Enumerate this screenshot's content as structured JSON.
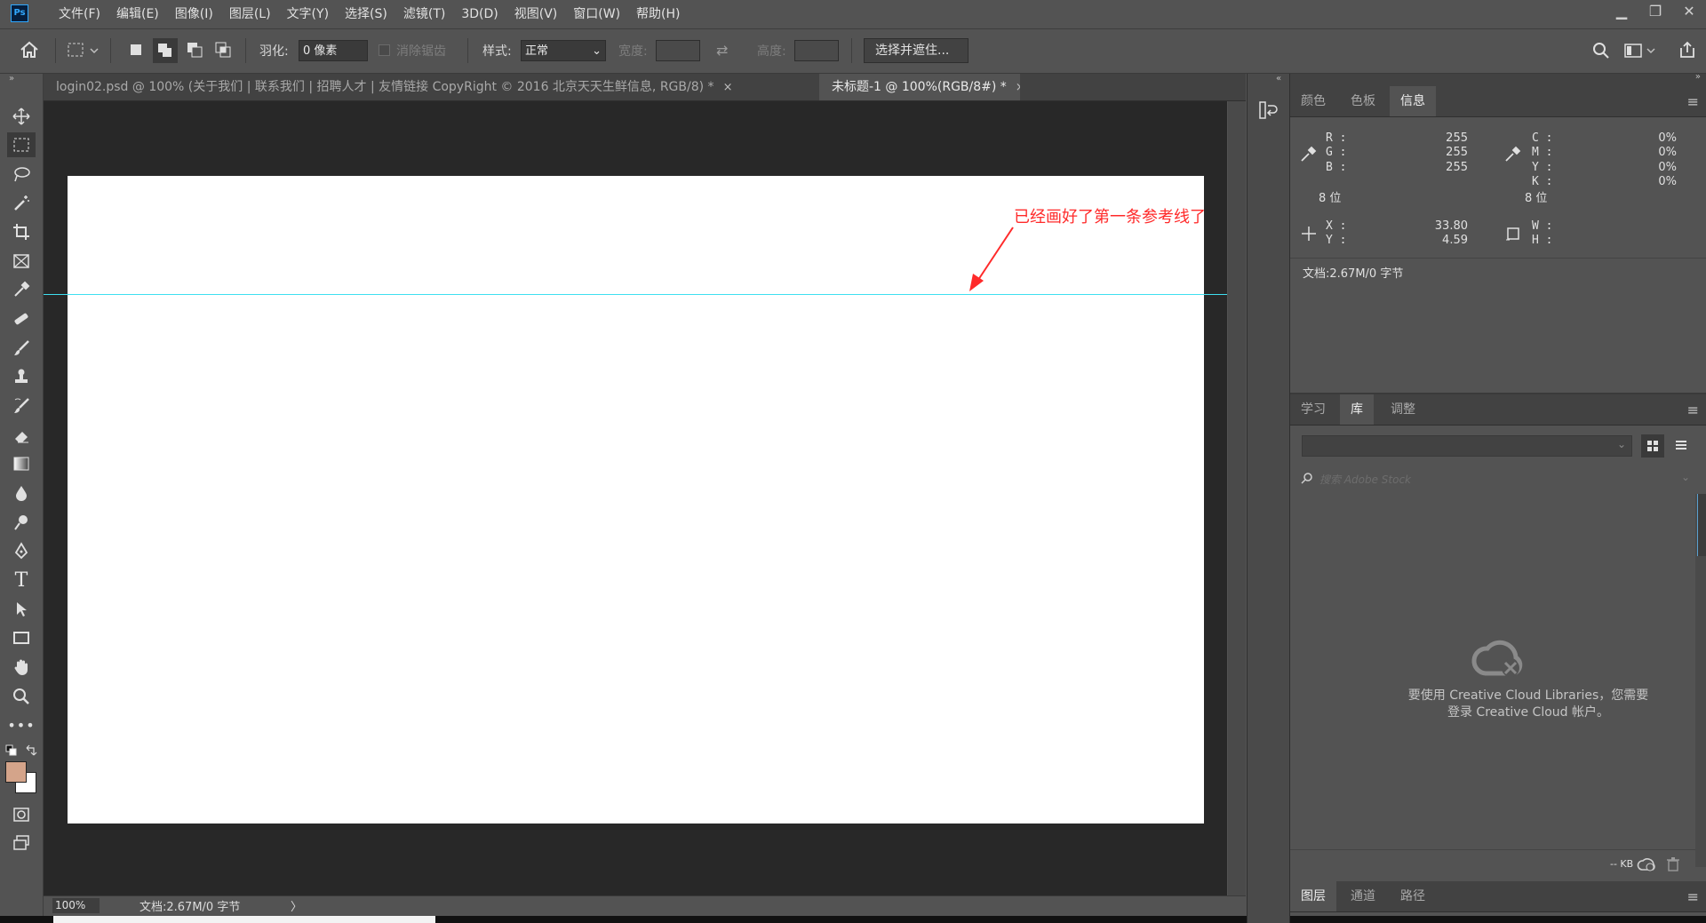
{
  "app": {
    "logo": "Ps"
  },
  "menu": [
    {
      "label": "文件(F)"
    },
    {
      "label": "编辑(E)"
    },
    {
      "label": "图像(I)"
    },
    {
      "label": "图层(L)"
    },
    {
      "label": "文字(Y)"
    },
    {
      "label": "选择(S)"
    },
    {
      "label": "滤镜(T)"
    },
    {
      "label": "3D(D)"
    },
    {
      "label": "视图(V)"
    },
    {
      "label": "窗口(W)"
    },
    {
      "label": "帮助(H)"
    }
  ],
  "window_controls": {
    "minimize": "▁",
    "restore": "❐",
    "close": "✕"
  },
  "options": {
    "feather_label": "羽化:",
    "feather_value": "0 像素",
    "antialias_label": "消除锯齿",
    "style_label": "样式:",
    "style_value": "正常",
    "width_label": "宽度:",
    "height_label": "高度:",
    "select_mask_button": "选择并遮住..."
  },
  "tabs": [
    {
      "label": "login02.psd @ 100% (关于我们   |   联系我们   |   招聘人才   |   友情链接 CopyRight © 2016 北京天天生鲜信息, RGB/8) *",
      "close": "×"
    },
    {
      "label": "未标题-1 @ 100%(RGB/8#) *",
      "close": "×"
    }
  ],
  "annotation": "已经画好了第一条参考线了",
  "status": {
    "zoom": "100%",
    "doc": "文档:2.67M/0 字节",
    "arrow": "〉"
  },
  "panel_top": {
    "tabs": [
      "颜色",
      "色板",
      "信息"
    ],
    "active": 2,
    "menu": "≡"
  },
  "info": {
    "r_label": "R :",
    "g_label": "G :",
    "b_label": "B :",
    "r": "255",
    "g": "255",
    "b": "255",
    "c_label": "C :",
    "m_label": "M :",
    "y_label": "Y :",
    "k_label": "K :",
    "c": "0%",
    "m": "0%",
    "y": "0%",
    "k": "0%",
    "bits_left": "8 位",
    "bits_right": "8 位",
    "x_label": "X :",
    "y2_label": "Y :",
    "x": "33.80",
    "y2": "4.59",
    "w_label": "W :",
    "h_label": "H :",
    "doc": "文档:2.67M/0 字节"
  },
  "panel_mid": {
    "tabs": [
      "学习",
      "库",
      "调整"
    ],
    "active": 1,
    "menu": "≡",
    "search_placeholder": "搜索 Adobe Stock",
    "message_line1": "要使用 Creative Cloud Libraries，您需要",
    "message_line2": "登录 Creative Cloud 帐户。",
    "footer_kb": "-- KB"
  },
  "panel_bottom": {
    "tabs": [
      "图层",
      "通道",
      "路径"
    ],
    "active": 0,
    "menu": "≡"
  },
  "colors": {
    "foreground": "#d4a48a",
    "background": "#ffffff",
    "guide": "#3ee0f0",
    "annotation": "#ff2a2a"
  }
}
